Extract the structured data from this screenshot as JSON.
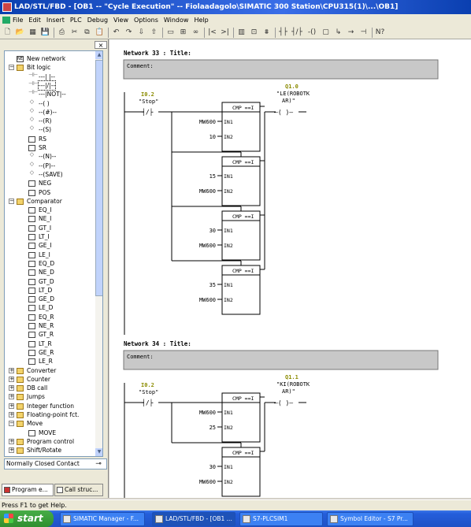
{
  "window": {
    "title": "LAD/STL/FBD - [OB1 -- \"Cycle Execution\" -- Fiolaadagolo\\SIMATIC 300 Station\\CPU315(1)\\...\\OB1]"
  },
  "menu": [
    "File",
    "Edit",
    "Insert",
    "PLC",
    "Debug",
    "View",
    "Options",
    "Window",
    "Help"
  ],
  "toolbar": {
    "buttons": [
      {
        "icon": "new-icon",
        "glyph": "🗋"
      },
      {
        "icon": "open-icon",
        "glyph": "📂"
      },
      {
        "icon": "catalog-icon",
        "glyph": "▦"
      },
      {
        "icon": "save-icon",
        "glyph": "💾"
      },
      {
        "icon": "print-icon",
        "glyph": "⎙"
      },
      {
        "icon": "cut-icon",
        "glyph": "✂"
      },
      {
        "icon": "copy-icon",
        "glyph": "⧉"
      },
      {
        "icon": "paste-icon",
        "glyph": "📋"
      },
      {
        "icon": "undo-icon",
        "glyph": "↶"
      },
      {
        "icon": "redo-icon",
        "glyph": "↷"
      },
      {
        "icon": "download-icon",
        "glyph": "⇩"
      },
      {
        "icon": "upload-icon",
        "glyph": "⇧"
      },
      {
        "icon": "monitor-icon",
        "glyph": "▭"
      },
      {
        "icon": "network-icon",
        "glyph": "⊞"
      },
      {
        "icon": "glasses-icon",
        "glyph": "∞"
      },
      {
        "icon": "prev-icon",
        "glyph": "|<"
      },
      {
        "icon": "next-icon",
        "glyph": ">|"
      },
      {
        "icon": "overview-icon",
        "glyph": "▥"
      },
      {
        "icon": "window-icon",
        "glyph": "⊡"
      },
      {
        "icon": "new-network-icon",
        "glyph": "⩩"
      },
      {
        "icon": "no-contact-icon",
        "glyph": "┤├"
      },
      {
        "icon": "nc-contact-icon",
        "glyph": "┤/├"
      },
      {
        "icon": "coil-icon",
        "glyph": "-()"
      },
      {
        "icon": "box-icon",
        "glyph": "▢"
      },
      {
        "icon": "branch-open-icon",
        "glyph": "↳"
      },
      {
        "icon": "branch-close-icon",
        "glyph": "→"
      },
      {
        "icon": "connection-icon",
        "glyph": "⊣"
      },
      {
        "icon": "help-icon",
        "glyph": "N?"
      }
    ]
  },
  "catalog": {
    "close_label": "×",
    "tree": [
      {
        "label": "New network",
        "level": 0,
        "kind": "net"
      },
      {
        "label": "Bit logic",
        "level": 0,
        "kind": "folder",
        "expander": "−"
      },
      {
        "label": "---| |--",
        "level": 1,
        "kind": "glyph",
        "glyph": "⊣⊢"
      },
      {
        "label": "---|/|--",
        "level": 1,
        "kind": "glyph",
        "glyph": "⊣⊢",
        "selected": true
      },
      {
        "label": "---|NOT|--",
        "level": 1,
        "kind": "glyph",
        "glyph": "⊣⊢"
      },
      {
        "label": "--( )",
        "level": 1,
        "kind": "glyph",
        "glyph": "◇"
      },
      {
        "label": "--(#)--",
        "level": 1,
        "kind": "glyph",
        "glyph": "◇"
      },
      {
        "label": "--(R)",
        "level": 1,
        "kind": "glyph",
        "glyph": "◇"
      },
      {
        "label": "--(S)",
        "level": 1,
        "kind": "glyph",
        "glyph": "◇"
      },
      {
        "label": "RS",
        "level": 1,
        "kind": "inst"
      },
      {
        "label": "SR",
        "level": 1,
        "kind": "inst"
      },
      {
        "label": "--(N)--",
        "level": 1,
        "kind": "glyph",
        "glyph": "◇"
      },
      {
        "label": "--(P)--",
        "level": 1,
        "kind": "glyph",
        "glyph": "◇"
      },
      {
        "label": "--(SAVE)",
        "level": 1,
        "kind": "glyph",
        "glyph": "◇"
      },
      {
        "label": "NEG",
        "level": 1,
        "kind": "inst"
      },
      {
        "label": "POS",
        "level": 1,
        "kind": "inst"
      },
      {
        "label": "Comparator",
        "level": 0,
        "kind": "folder",
        "expander": "−"
      },
      {
        "label": "EQ_I",
        "level": 1,
        "kind": "inst"
      },
      {
        "label": "NE_I",
        "level": 1,
        "kind": "inst"
      },
      {
        "label": "GT_I",
        "level": 1,
        "kind": "inst"
      },
      {
        "label": "LT_I",
        "level": 1,
        "kind": "inst"
      },
      {
        "label": "GE_I",
        "level": 1,
        "kind": "inst"
      },
      {
        "label": "LE_I",
        "level": 1,
        "kind": "inst"
      },
      {
        "label": "EQ_D",
        "level": 1,
        "kind": "inst"
      },
      {
        "label": "NE_D",
        "level": 1,
        "kind": "inst"
      },
      {
        "label": "GT_D",
        "level": 1,
        "kind": "inst"
      },
      {
        "label": "LT_D",
        "level": 1,
        "kind": "inst"
      },
      {
        "label": "GE_D",
        "level": 1,
        "kind": "inst"
      },
      {
        "label": "LE_D",
        "level": 1,
        "kind": "inst"
      },
      {
        "label": "EQ_R",
        "level": 1,
        "kind": "inst"
      },
      {
        "label": "NE_R",
        "level": 1,
        "kind": "inst"
      },
      {
        "label": "GT_R",
        "level": 1,
        "kind": "inst"
      },
      {
        "label": "LT_R",
        "level": 1,
        "kind": "inst"
      },
      {
        "label": "GE_R",
        "level": 1,
        "kind": "inst"
      },
      {
        "label": "LE_R",
        "level": 1,
        "kind": "inst"
      },
      {
        "label": "Converter",
        "level": 0,
        "kind": "folder",
        "expander": "+"
      },
      {
        "label": "Counter",
        "level": 0,
        "kind": "folder",
        "expander": "+"
      },
      {
        "label": "DB call",
        "level": 0,
        "kind": "folder",
        "expander": "+"
      },
      {
        "label": "Jumps",
        "level": 0,
        "kind": "folder",
        "expander": "+"
      },
      {
        "label": "Integer function",
        "level": 0,
        "kind": "folder",
        "expander": "+"
      },
      {
        "label": "Floating-point fct.",
        "level": 0,
        "kind": "folder",
        "expander": "+"
      },
      {
        "label": "Move",
        "level": 0,
        "kind": "folder",
        "expander": "−"
      },
      {
        "label": "MOVE",
        "level": 1,
        "kind": "inst"
      },
      {
        "label": "Program control",
        "level": 0,
        "kind": "folder",
        "expander": "+"
      },
      {
        "label": "Shift/Rotate",
        "level": 0,
        "kind": "folder",
        "expander": "+"
      }
    ],
    "status_text": "Normally Closed Contact",
    "tabs": [
      "Program e...",
      "Call struc..."
    ]
  },
  "networks": [
    {
      "header": "Network 33 : Title:",
      "comment": "Comment:",
      "contact_addr": "I0.2",
      "contact_sym": "\"Stop\"",
      "coil_addr": "Q1.0",
      "coil_sym": [
        "\"LE(ROBOTK",
        "AR)\""
      ],
      "boxes": [
        {
          "title": "CMP ==I",
          "in1": "MW600",
          "in2": "10"
        },
        {
          "title": "CMP ==I",
          "in1": "15",
          "in2": "MW600"
        },
        {
          "title": "CMP ==I",
          "in1": "30",
          "in2": "MW600"
        },
        {
          "title": "CMP ==I",
          "in1": "35",
          "in2": "MW600"
        }
      ]
    },
    {
      "header": "Network 34 : Title:",
      "comment": "Comment:",
      "contact_addr": "I0.2",
      "contact_sym": "\"Stop\"",
      "coil_addr": "Q1.1",
      "coil_sym": [
        "\"KI(ROBOTK",
        "AR)\""
      ],
      "boxes": [
        {
          "title": "CMP ==I",
          "in1": "MW600",
          "in2": "25"
        },
        {
          "title": "CMP ==I",
          "in1": "30",
          "in2": "MW600"
        }
      ]
    }
  ],
  "pin_labels": {
    "in1": "IN1",
    "in2": "IN2"
  },
  "statusbar": "Press F1 to get Help.",
  "taskbar": {
    "start": "start",
    "tasks": [
      "SIMATIC Manager - F...",
      "LAD/STL/FBD - [OB1 ...",
      "S7-PLCSIM1",
      "Symbol Editor - S7 Pr..."
    ]
  },
  "colors": {
    "address": "#8b8b00",
    "titlebar": "#0a3fb0",
    "taskbar": "#245edb",
    "comment_bg": "#c8c8c8"
  }
}
